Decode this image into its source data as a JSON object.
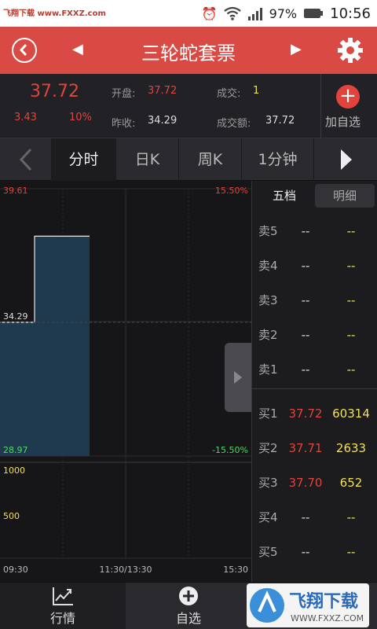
{
  "status": {
    "watermark": "飞翔下载 www.FXXZ.com",
    "battery": "97%",
    "time": "10:56"
  },
  "header": {
    "title": "三轮蛇套票",
    "prev": "◀",
    "next": "▶"
  },
  "quote": {
    "price": "37.72",
    "change": "3.43",
    "pct": "10%",
    "open_label": "开盘:",
    "open": "37.72",
    "vol_label": "成交:",
    "vol": "1",
    "prev_label": "昨收:",
    "prev_close": "34.29",
    "amt_label": "成交额:",
    "amt": "37.72",
    "add_label": "加自选"
  },
  "tabs": [
    "分时",
    "日K",
    "周K",
    "1分钟"
  ],
  "chart_data": {
    "type": "area",
    "price_high": "39.61",
    "price_low": "28.97",
    "price_ref": "34.29",
    "pct_high": "15.50%",
    "pct_low": "-15.50%",
    "vol_high": "1000",
    "vol_mid": "500",
    "x_ticks": [
      "09:30",
      "11:30/13:30",
      "15:30"
    ],
    "series": [
      {
        "x": [
          "09:30",
          "10:00"
        ],
        "values": [
          37.72,
          37.72
        ]
      }
    ]
  },
  "side": {
    "tab_active": "五档",
    "tab_other": "明细",
    "sell": [
      {
        "label": "卖5",
        "price": "--",
        "vol": "--"
      },
      {
        "label": "卖4",
        "price": "--",
        "vol": "--"
      },
      {
        "label": "卖3",
        "price": "--",
        "vol": "--"
      },
      {
        "label": "卖2",
        "price": "--",
        "vol": "--"
      },
      {
        "label": "卖1",
        "price": "--",
        "vol": "--"
      }
    ],
    "buy": [
      {
        "label": "买1",
        "price": "37.72",
        "vol": "60314"
      },
      {
        "label": "买2",
        "price": "37.71",
        "vol": "2633"
      },
      {
        "label": "买3",
        "price": "37.70",
        "vol": "652"
      },
      {
        "label": "买4",
        "price": "--",
        "vol": "--"
      },
      {
        "label": "买5",
        "price": "--",
        "vol": "--"
      }
    ]
  },
  "nav": {
    "market": "行情",
    "watch": "自选"
  },
  "watermark_logo": {
    "text": "飞翔下载",
    "url": "WWW.FXXZ.COM"
  },
  "colors": {
    "accent": "#d94a44",
    "up": "#e0443c",
    "vol": "#f0e060",
    "area": "#1f3a4f"
  }
}
